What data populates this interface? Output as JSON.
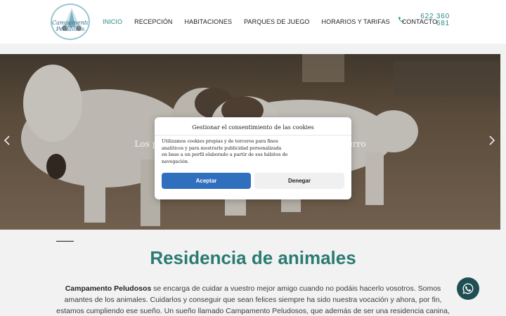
{
  "header": {
    "logo_text": "Campamento Peludosos",
    "nav": [
      {
        "label": "INICIO",
        "active": true
      },
      {
        "label": "RECEPCIÓN",
        "active": false
      },
      {
        "label": "HABITACIONES",
        "active": false
      },
      {
        "label": "PARQUES DE JUEGO",
        "active": false
      },
      {
        "label": "HORARIOS Y TARIFAS",
        "active": false
      },
      {
        "label": "CONTACTO",
        "active": false
      }
    ],
    "phone_icon": "phone-icon",
    "phone_line1": "622 360",
    "phone_line2": "681"
  },
  "hero": {
    "caption": "Los parques de juego son el lugar favorito de tu perro",
    "prev_icon": "chevron-left-icon",
    "next_icon": "chevron-right-icon"
  },
  "cookie_modal": {
    "title": "Gestionar el consentimiento de las cookies",
    "text": "Utilizamos cookies propias y de terceros para fines analíticos y para mostrarle publicidad personalizada en base a un perfil elaborado a partir de sus hábitos de navegación.",
    "accept_label": "Aceptar",
    "deny_label": "Denegar"
  },
  "main": {
    "heading": "Residencia de animales",
    "intro_bold": "Campamento Peludosos",
    "intro_text": " se encarga de cuidar a vuestro mejor amigo cuando no podáis hacerlo vosotros. Somos amantes de los animales. Cuidarlos y conseguir que sean felices siempre ha sido nuestra vocación y ahora, por fin, estamos cumpliendo ese sueño. Un sueño llamado Campamento Peludosos, que además de ser una residencia canina, es nuestro hogar. Tu perro"
  },
  "colors": {
    "accent": "#2a8a86",
    "heading": "#2a7b73",
    "accept_button": "#2f6fbd",
    "whatsapp_button": "#1f4f52"
  },
  "whatsapp": {
    "icon": "whatsapp-icon"
  }
}
